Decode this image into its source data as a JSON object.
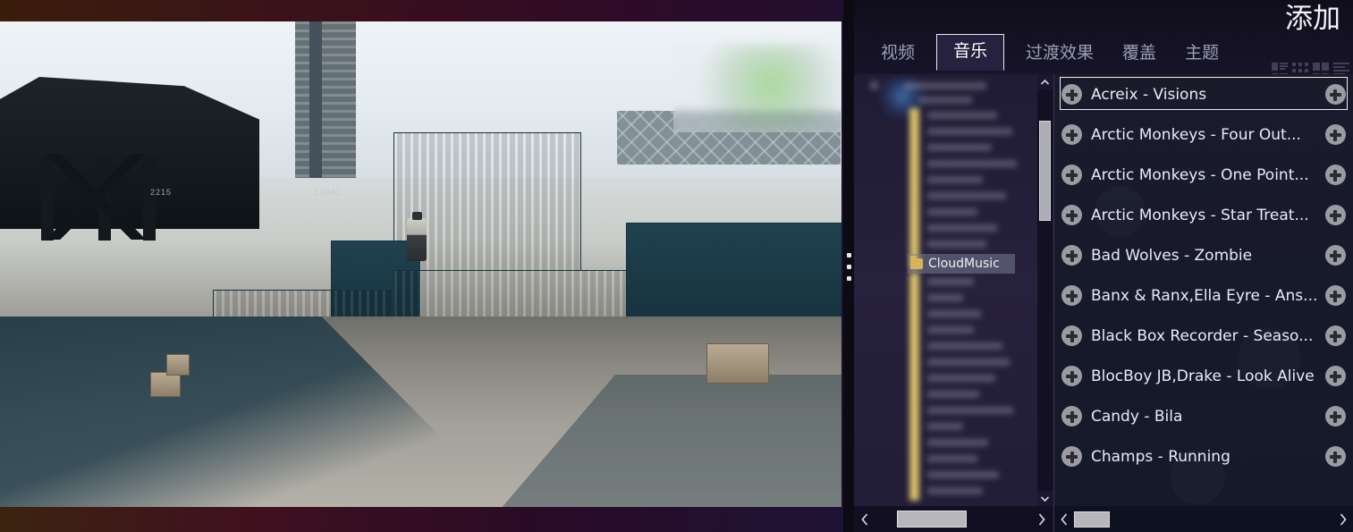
{
  "window": {
    "title": "添加"
  },
  "tabs": [
    {
      "label": "视频",
      "name": "tab-video",
      "active": false
    },
    {
      "label": "音乐",
      "name": "tab-music",
      "active": true
    },
    {
      "label": "过渡效果",
      "name": "tab-transitions",
      "active": false
    },
    {
      "label": "覆盖",
      "name": "tab-overlay",
      "active": false
    },
    {
      "label": "主题",
      "name": "tab-theme",
      "active": false
    }
  ],
  "view_modes": [
    {
      "name": "view-mode-large-icons-icon"
    },
    {
      "name": "view-mode-grid-icon"
    },
    {
      "name": "view-mode-tiles-icon"
    },
    {
      "name": "view-mode-list-icon"
    }
  ],
  "tree": {
    "selected_folder": "CloudMusic",
    "folder_icon": "folder-icon",
    "scroll_up_icon": "chevron-up-icon",
    "scroll_down_icon": "chevron-down-icon",
    "scroll_left_icon": "chevron-left-icon",
    "scroll_right_icon": "chevron-right-icon"
  },
  "list": {
    "add_icon": "plus-circle-icon",
    "scroll_left_icon": "chevron-left-icon",
    "scroll_right_icon": "chevron-right-icon",
    "tracks": [
      {
        "name": "Acreix - Visions",
        "selected": true
      },
      {
        "name": "Arctic Monkeys - Four Out...",
        "selected": false
      },
      {
        "name": "Arctic Monkeys - One Point...",
        "selected": false
      },
      {
        "name": "Arctic Monkeys - Star Treat...",
        "selected": false
      },
      {
        "name": "Bad Wolves - Zombie",
        "selected": false
      },
      {
        "name": "Banx & Ranx,Ella Eyre - Ans...",
        "selected": false
      },
      {
        "name": "Black Box Recorder - Seaso...",
        "selected": false
      },
      {
        "name": "BlocBoy JB,Drake - Look Alive",
        "selected": false
      },
      {
        "name": "Candy - Bila",
        "selected": false
      },
      {
        "name": "Champs - Running",
        "selected": false
      }
    ]
  },
  "video_preview": {
    "description": "game-scene-shipping-containers"
  },
  "colors": {
    "panel_bg": "#17142a",
    "list_bg": "#171a2b",
    "accent_selected_border": "#eceef4",
    "tab_active_bg": "#26213f",
    "text_primary": "#e9ecf4",
    "text_muted": "#9aa0b5",
    "plus_circle": "#9b9ba3",
    "scrollbar_thumb": "#b6b6bb",
    "folder_yellow": "#d8b455"
  }
}
